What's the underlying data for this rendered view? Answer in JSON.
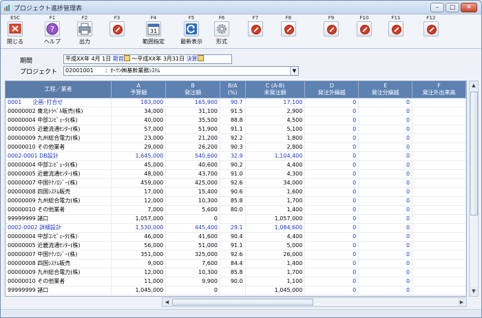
{
  "window": {
    "title": "プロジェクト進捗管理表"
  },
  "toolbar": [
    {
      "key": "ESC",
      "label": "閉じる",
      "icon": "close-app-icon"
    },
    {
      "key": "F1",
      "label": "ヘルプ",
      "icon": "help-icon"
    },
    {
      "key": "F2",
      "label": "出力",
      "icon": "print-icon"
    },
    {
      "key": "F3",
      "label": "",
      "icon": "disabled-icon"
    },
    {
      "key": "F4",
      "label": "範囲指定",
      "icon": "calendar-icon"
    },
    {
      "key": "F5",
      "label": "最新表示",
      "icon": "refresh-icon"
    },
    {
      "key": "F6",
      "label": "形式",
      "icon": "gear-icon"
    },
    {
      "key": "F7",
      "label": "",
      "icon": "disabled-icon"
    },
    {
      "key": "F8",
      "label": "",
      "icon": "disabled-icon"
    },
    {
      "key": "F9",
      "label": "",
      "icon": "disabled-icon"
    },
    {
      "key": "F10",
      "label": "",
      "icon": "disabled-icon"
    },
    {
      "key": "F11",
      "label": "",
      "icon": "disabled-icon"
    },
    {
      "key": "F12",
      "label": "",
      "icon": "disabled-icon"
    }
  ],
  "filters": {
    "period_label": "期間",
    "period_from": "平成XX年 4月 1日",
    "period_from_tag": "期首",
    "period_sep": "～",
    "period_to": "平成XX年 3月31日",
    "period_to_tag": "決算",
    "project_label": "プロジェクト",
    "project_code": "02001001",
    "project_name": "：ｵｰｸﾝ㈱基幹業務ｼｽﾃﾑ"
  },
  "grid": {
    "headers": [
      {
        "top": "",
        "bottom": "工程／業者"
      },
      {
        "top": "A",
        "bottom": "予算額"
      },
      {
        "top": "B",
        "bottom": "発注額"
      },
      {
        "top": "B/A",
        "bottom": "(%)"
      },
      {
        "top": "C (A-B)",
        "bottom": "未発注額"
      },
      {
        "top": "D",
        "bottom": "発注外繰越"
      },
      {
        "top": "E",
        "bottom": "発注分繰越"
      },
      {
        "top": "F",
        "bottom": "発注外出来高"
      }
    ],
    "rows": [
      {
        "group": true,
        "name": "0001　　企画･打合せ",
        "a": "183,000",
        "b": "165,900",
        "ratio": "90.7",
        "c": "17,100",
        "d": "0",
        "e": "0",
        "f": ""
      },
      {
        "group": false,
        "name": "00000002 東北ﾄﾗﾍﾞﾙ販売(株)",
        "a": "34,000",
        "b": "31,100",
        "ratio": "91.5",
        "c": "2,900",
        "d": "0",
        "e": "0",
        "f": ""
      },
      {
        "group": false,
        "name": "00000004 中部ｺﾝﾋﾟｭｰﾀ(株)",
        "a": "40,000",
        "b": "35,500",
        "ratio": "88.8",
        "c": "4,500",
        "d": "0",
        "e": "0",
        "f": ""
      },
      {
        "group": false,
        "name": "00000005 近畿流通ｾﾝﾀｰ(株)",
        "a": "57,000",
        "b": "51,900",
        "ratio": "91.1",
        "c": "5,100",
        "d": "0",
        "e": "0",
        "f": ""
      },
      {
        "group": false,
        "name": "00000009 九州総合電力(株)",
        "a": "23,000",
        "b": "21,200",
        "ratio": "92.2",
        "c": "1,800",
        "d": "0",
        "e": "0",
        "f": ""
      },
      {
        "group": false,
        "name": "00000010 その他業者",
        "a": "29,000",
        "b": "26,200",
        "ratio": "90.3",
        "c": "2,800",
        "d": "0",
        "e": "0",
        "f": ""
      },
      {
        "group": true,
        "name": "0002-0001 DB設計",
        "a": "1,645,000",
        "b": "540,600",
        "ratio": "32.9",
        "c": "1,104,400",
        "d": "0",
        "e": "0",
        "f": ""
      },
      {
        "group": false,
        "name": "00000004 中部ｺﾝﾋﾟｭｰﾀ(株)",
        "a": "45,000",
        "b": "40,600",
        "ratio": "90.2",
        "c": "4,400",
        "d": "0",
        "e": "0",
        "f": ""
      },
      {
        "group": false,
        "name": "00000005 近畿流通ｾﾝﾀｰ(株)",
        "a": "48,000",
        "b": "43,700",
        "ratio": "91.0",
        "c": "4,300",
        "d": "0",
        "e": "0",
        "f": ""
      },
      {
        "group": false,
        "name": "00000007 中国ﾃｸﾉﾛｼﾞｰ(株)",
        "a": "459,000",
        "b": "425,000",
        "ratio": "92.6",
        "c": "34,000",
        "d": "0",
        "e": "0",
        "f": ""
      },
      {
        "group": false,
        "name": "00000008 四国ｼｽﾃﾑ販売",
        "a": "17,000",
        "b": "15,400",
        "ratio": "90.6",
        "c": "1,600",
        "d": "0",
        "e": "0",
        "f": ""
      },
      {
        "group": false,
        "name": "00000009 九州総合電力(株)",
        "a": "12,000",
        "b": "10,300",
        "ratio": "85.8",
        "c": "1,700",
        "d": "0",
        "e": "0",
        "f": ""
      },
      {
        "group": false,
        "name": "00000010 その他業者",
        "a": "7,000",
        "b": "5,600",
        "ratio": "80.0",
        "c": "1,400",
        "d": "0",
        "e": "0",
        "f": ""
      },
      {
        "group": false,
        "name": "99999999 諸口",
        "a": "1,057,000",
        "b": "0",
        "ratio": "",
        "c": "1,057,000",
        "d": "0",
        "e": "0",
        "f": ""
      },
      {
        "group": true,
        "name": "0002-0002 詳細設計",
        "a": "1,530,000",
        "b": "445,400",
        "ratio": "29.1",
        "c": "1,084,600",
        "d": "0",
        "e": "0",
        "f": ""
      },
      {
        "group": false,
        "name": "00000004 中部ｺﾝﾋﾟｭｰﾀ(株)",
        "a": "46,000",
        "b": "41,600",
        "ratio": "90.4",
        "c": "4,400",
        "d": "0",
        "e": "0",
        "f": ""
      },
      {
        "group": false,
        "name": "00000005 近畿流通ｾﾝﾀｰ(株)",
        "a": "56,000",
        "b": "51,000",
        "ratio": "91.1",
        "c": "5,000",
        "d": "0",
        "e": "0",
        "f": ""
      },
      {
        "group": false,
        "name": "00000007 中国ﾃｸﾉﾛｼﾞｰ(株)",
        "a": "351,000",
        "b": "325,000",
        "ratio": "92.6",
        "c": "26,000",
        "d": "0",
        "e": "0",
        "f": ""
      },
      {
        "group": false,
        "name": "00000008 四国ｼｽﾃﾑ販売",
        "a": "9,000",
        "b": "7,600",
        "ratio": "84.4",
        "c": "1,400",
        "d": "0",
        "e": "0",
        "f": ""
      },
      {
        "group": false,
        "name": "00000009 九州総合電力(株)",
        "a": "12,000",
        "b": "10,300",
        "ratio": "85.8",
        "c": "1,700",
        "d": "0",
        "e": "0",
        "f": ""
      },
      {
        "group": false,
        "name": "00000010 その他業者",
        "a": "11,000",
        "b": "9,900",
        "ratio": "90.0",
        "c": "1,100",
        "d": "0",
        "e": "0",
        "f": ""
      },
      {
        "group": false,
        "name": "99999999 諸口",
        "a": "1,045,000",
        "b": "0",
        "ratio": "",
        "c": "1,045,000",
        "d": "0",
        "e": "0",
        "f": ""
      }
    ]
  }
}
